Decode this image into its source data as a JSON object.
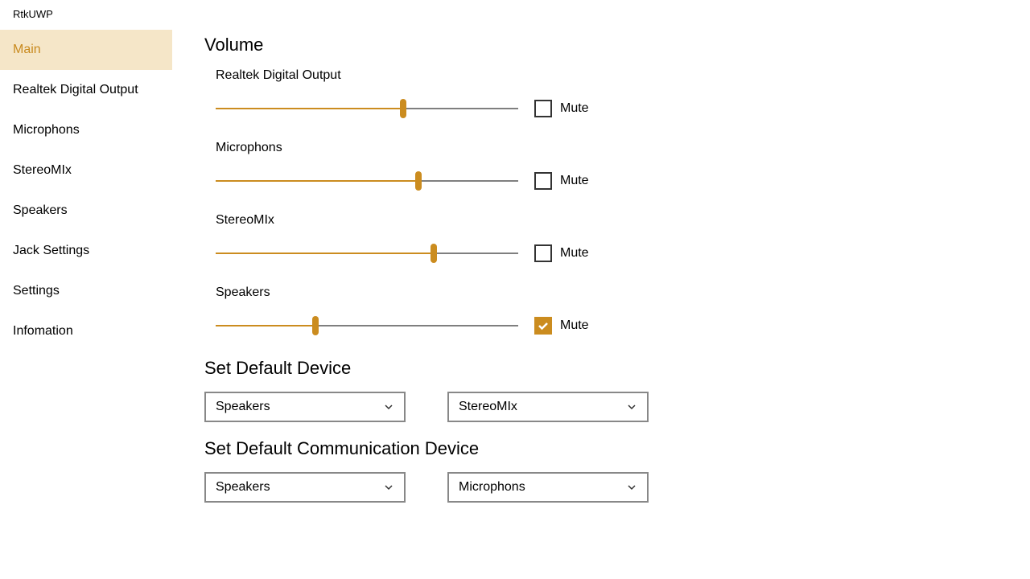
{
  "app_title": "RtkUWP",
  "sidebar": {
    "items": [
      {
        "label": "Main",
        "active": true
      },
      {
        "label": "Realtek Digital Output",
        "active": false
      },
      {
        "label": "Microphons",
        "active": false
      },
      {
        "label": "StereoMIx",
        "active": false
      },
      {
        "label": "Speakers",
        "active": false
      },
      {
        "label": "Jack Settings",
        "active": false
      },
      {
        "label": "Settings",
        "active": false
      },
      {
        "label": "Infomation",
        "active": false
      }
    ]
  },
  "sections": {
    "volume_title": "Volume",
    "default_device_title": "Set Default Device",
    "default_comm_title": "Set Default Communication Device"
  },
  "mute_label": "Mute",
  "volumes": [
    {
      "label": "Realtek Digital Output",
      "value": 62,
      "mute": false
    },
    {
      "label": "Microphons",
      "value": 67,
      "mute": false
    },
    {
      "label": "StereoMIx",
      "value": 72,
      "mute": false
    },
    {
      "label": "Speakers",
      "value": 33,
      "mute": true
    }
  ],
  "default_device": {
    "output": "Speakers",
    "input": "StereoMIx"
  },
  "default_comm_device": {
    "output": "Speakers",
    "input": "Microphons"
  }
}
